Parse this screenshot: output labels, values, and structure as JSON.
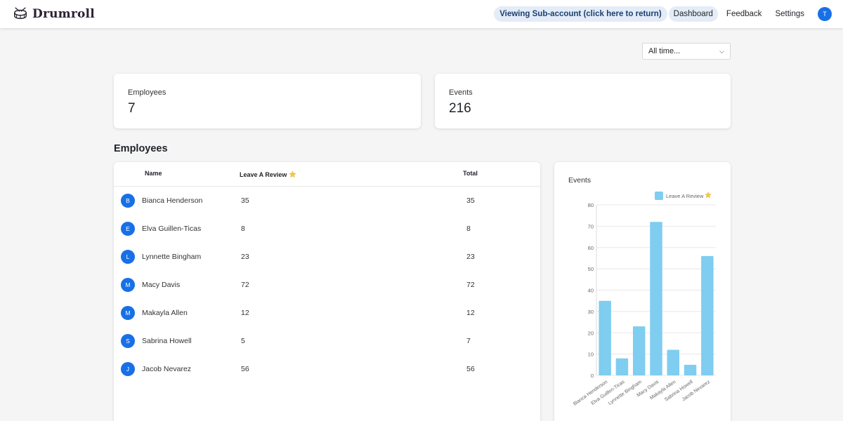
{
  "brand": {
    "name": "Drumroll",
    "logo_icon": "drum-logo-icon"
  },
  "nav": {
    "subaccount": "Viewing Sub-account (click here to return)",
    "dashboard": "Dashboard",
    "feedback": "Feedback",
    "settings": "Settings",
    "avatar_initial": "T",
    "accent": "#1870e6"
  },
  "filter": {
    "selected": "All time..."
  },
  "stats": [
    {
      "label": "Employees",
      "value": "7"
    },
    {
      "label": "Events",
      "value": "216"
    }
  ],
  "employees": {
    "title": "Employees",
    "columns": {
      "name": "Name",
      "review": "Leave A Review",
      "review_icon": "star-icon",
      "total": "Total"
    },
    "rows": [
      {
        "initial": "B",
        "name": "Bianca Henderson",
        "review": "35",
        "total": "35"
      },
      {
        "initial": "E",
        "name": "Elva Guillen-Ticas",
        "review": "8",
        "total": "8"
      },
      {
        "initial": "L",
        "name": "Lynnette Bingham",
        "review": "23",
        "total": "23"
      },
      {
        "initial": "M",
        "name": "Macy Davis",
        "review": "72",
        "total": "72"
      },
      {
        "initial": "M",
        "name": "Makayla Allen",
        "review": "12",
        "total": "12"
      },
      {
        "initial": "S",
        "name": "Sabrina Howell",
        "review": "5",
        "total": "7"
      },
      {
        "initial": "J",
        "name": "Jacob Nevarez",
        "review": "56",
        "total": "56"
      }
    ]
  },
  "chart_data": {
    "type": "bar",
    "title": "Events",
    "categories": [
      "Bianca Henderson",
      "Elva Guillen-Ticas",
      "Lynnette Bingham",
      "Macy Davis",
      "Makayla Allen",
      "Sabrina Howell",
      "Jacob Nevarez"
    ],
    "series": [
      {
        "name": "Leave A Review",
        "legend_icon": "star-icon",
        "values": [
          35,
          8,
          23,
          72,
          12,
          5,
          56
        ],
        "color": "#7fcdf0"
      }
    ],
    "ylim": [
      0,
      80
    ],
    "yticks": [
      0,
      10,
      20,
      30,
      40,
      50,
      60,
      70,
      80
    ],
    "grid": true,
    "legend": "top-right"
  }
}
